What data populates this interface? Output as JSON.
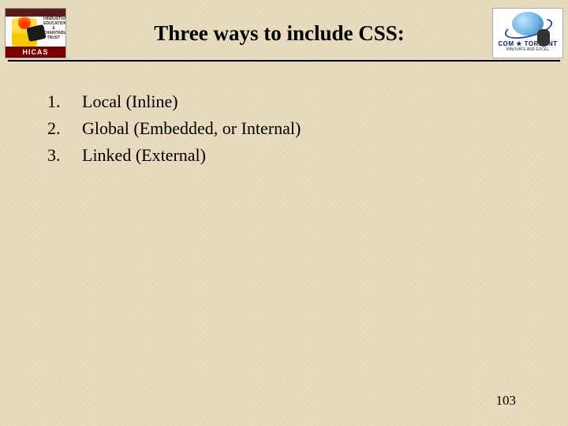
{
  "header": {
    "title": "Three ways to include CSS:",
    "logo_left": {
      "side_text": "HINDUSTHAN EDUCATIONAL & CHARITABLE TRUST",
      "bottom_label": "HICAS"
    },
    "logo_right": {
      "brand": "COM ★ TORRENT",
      "tagline": "INNOVATE AND EXCEL"
    }
  },
  "list": {
    "items": [
      {
        "num": "1.",
        "text": "Local (Inline)"
      },
      {
        "num": "2.",
        "text": "Global (Embedded, or Internal)"
      },
      {
        "num": "3.",
        "text": "Linked (External)"
      }
    ]
  },
  "page_number": "103"
}
